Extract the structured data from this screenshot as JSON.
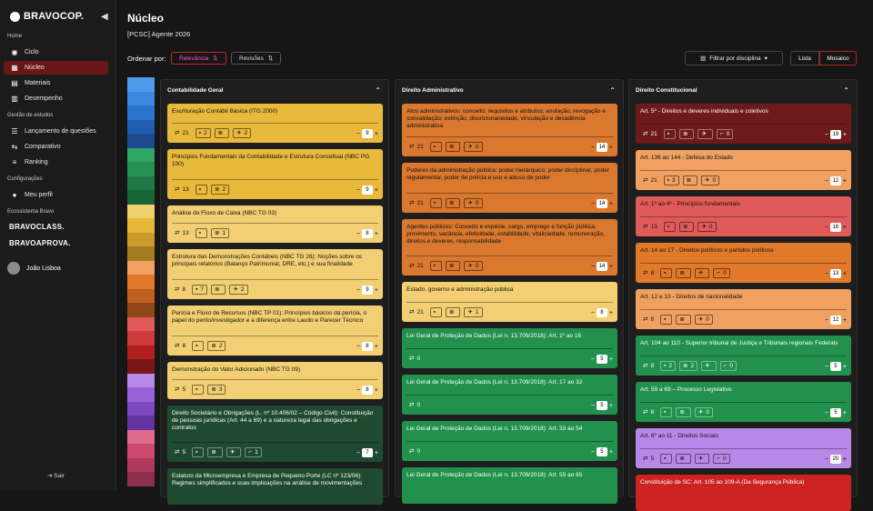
{
  "app": {
    "brand": "BRAVOCOP.",
    "page_title": "Núcleo",
    "subtitle": "[PCSC] Agente 2026"
  },
  "sidebar": {
    "sections": [
      "Home",
      "Gestão de estudos",
      "Configurações",
      "Ecossistema Bravo"
    ],
    "items": [
      {
        "label": "Ciclo",
        "icon": "cycle-icon"
      },
      {
        "label": "Núcleo",
        "icon": "grid-icon"
      },
      {
        "label": "Materiais",
        "icon": "book-icon"
      },
      {
        "label": "Desempenho",
        "icon": "chart-icon"
      },
      {
        "label": "Lançamento de questões",
        "icon": "list-icon"
      },
      {
        "label": "Comparativo",
        "icon": "compare-icon"
      },
      {
        "label": "Ranking",
        "icon": "ranking-icon"
      },
      {
        "label": "Meu perfil",
        "icon": "user-icon"
      }
    ],
    "ecosystem": [
      "BRAVOCLASS.",
      "BRAVOAPROVA."
    ],
    "user": "João Lisboa",
    "logout": "Sair"
  },
  "sort": {
    "label": "Ordenar por:",
    "options": [
      "Relevância",
      "Revisões"
    ]
  },
  "filter": {
    "label": "Filtrar por disciplina"
  },
  "view": {
    "list": "Lista",
    "mosaic": "Mosaico"
  },
  "strip_colors": [
    "#4f9ae8",
    "#3a88e0",
    "#2b74cc",
    "#1f5eb0",
    "#1c4a8f",
    "#2fa765",
    "#249052",
    "#1e7a44",
    "#186436",
    "#f0cf6e",
    "#e7b93a",
    "#cc9a2a",
    "#a37c22",
    "#f0a060",
    "#e07a2a",
    "#c0601e",
    "#8f4716",
    "#e05a5a",
    "#cc3a3a",
    "#b01e1e",
    "#7a1616",
    "#b888e8",
    "#9a62d8",
    "#7e48c0",
    "#6234a0",
    "#e06a8a",
    "#cc4a70",
    "#b03a5e",
    "#8f2e4c"
  ],
  "columns": [
    {
      "title": "Contabilidade Geral",
      "cards": [
        {
          "title": "Escrituração Contábil Básica (ITG 2000)",
          "color": "#e9b93c",
          "tags": [
            "21",
            "2",
            "",
            "2"
          ],
          "count": "9"
        },
        {
          "title": "Princípios Fundamentais da Contabilidade e Estrutura Conceitual (NBC PG 100)",
          "color": "#e9b93c",
          "tags": [
            "13",
            "",
            "2"
          ],
          "count": "9"
        },
        {
          "title": "Análise do Fluxo de Caixa (NBC TG 03)",
          "color": "#f2cf72",
          "tags": [
            "13",
            "",
            "1"
          ],
          "count": "8"
        },
        {
          "title": "Estrutura das Demonstrações Contábeis (NBC TG 26): Noções sobre os principais relatórios (Balanço Patrimonial, DRE, etc.) e sua finalidade",
          "color": "#f2cf72",
          "tags": [
            "8",
            "7",
            "",
            "2"
          ],
          "count": "9"
        },
        {
          "title": "Perícia e Fluxo de Recursos (NBC TP 01): Princípios básicos da perícia, o papel do perito/investigador e a diferença entre Laudo e Parecer Técnico",
          "color": "#f2cf72",
          "tags": [
            "8",
            "",
            "2"
          ],
          "count": "8"
        },
        {
          "title": "Demonstração do Valor Adicionado (NBC TG 09)",
          "color": "#f2cf72",
          "tags": [
            "5",
            "",
            "3"
          ],
          "count": "8"
        },
        {
          "title": "Direito Societário e Obrigações (L. nº 10.406/02 – Código Civil): Constituição de pessoas jurídicas (Art. 44 a 69) e a natureza legal das obrigações e contratos",
          "color": "#1e4a30",
          "tags": [
            "5",
            "",
            "",
            "",
            "1"
          ],
          "count": "7"
        },
        {
          "title": "Estatuto da Microempresa e Empresa de Pequeno Porte (LC nº 123/06): Regimes simplificados e suas implicações na análise de movimentações",
          "color": "#1e4a30",
          "tags": [],
          "count": ""
        }
      ]
    },
    {
      "title": "Direito Administrativo",
      "cards": [
        {
          "title": "Atos administrativos: conceito; requisitos e atributos; anulação, revogação e convalidação; extinção, discricionariedade, vinculação e decadência administrativa",
          "color": "#d9782e",
          "tags": [
            "21",
            "",
            "",
            "0"
          ],
          "count": "14"
        },
        {
          "title": "Poderes da administração pública: poder hierárquico; poder disciplinar, poder regulamentar, poder de polícia e uso e abuso de poder",
          "color": "#d9782e",
          "tags": [
            "21",
            "",
            "",
            "0"
          ],
          "count": "14"
        },
        {
          "title": "Agentes públicos: Conceito e espécie, cargo, emprego e função pública, provimento, vacância, efetividade, estabilidade, vitaliciedade, remuneração, direitos e deveres, responsabilidade",
          "color": "#d9782e",
          "tags": [
            "21",
            "",
            "",
            "0"
          ],
          "count": "14"
        },
        {
          "title": "Estado, governo e administração pública",
          "color": "#f2cf72",
          "tags": [
            "21",
            "",
            "",
            "1"
          ],
          "count": "8"
        },
        {
          "title": "Lei Geral de Proteção de Dados (Lei n. 13.709/2018): Art. 1º ao 16",
          "color": "#22914e",
          "tags": [
            "0"
          ],
          "count": "5"
        },
        {
          "title": "Lei Geral de Proteção de Dados (Lei n. 13.709/2018): Art. 17 ao 32",
          "color": "#22914e",
          "tags": [
            "0"
          ],
          "count": "5"
        },
        {
          "title": "Lei Geral de Proteção de Dados (Lei n. 13.709/2018): Art. 33 ao 54",
          "color": "#22914e",
          "tags": [
            "0"
          ],
          "count": "5"
        },
        {
          "title": "Lei Geral de Proteção de Dados (Lei n. 13.709/2018): Art. 55 ao 65",
          "color": "#22914e",
          "tags": [],
          "count": ""
        }
      ]
    },
    {
      "title": "Direito Constitucional",
      "cards": [
        {
          "title": "Art. 5º - Direitos e deveres individuais e coletivos",
          "color": "#6e1a1a",
          "tags": [
            "21",
            "",
            "",
            "",
            "0"
          ],
          "count": "19"
        },
        {
          "title": "Art. 136 ao 144 - Defesa do Estado",
          "color": "#f0a060",
          "tags": [
            "21",
            "3",
            "",
            "0"
          ],
          "count": "12"
        },
        {
          "title": "Art. 1º ao 4º - Princípios fundamentais",
          "color": "#e05a5a",
          "tags": [
            "13",
            "",
            "",
            "0"
          ],
          "count": "16"
        },
        {
          "title": "Art. 14 ao 17 - Direitos políticos e partidos políticos",
          "color": "#e07a2a",
          "tags": [
            "8",
            "",
            "",
            "",
            "0"
          ],
          "count": "13"
        },
        {
          "title": "Art. 12 e 13 - Direitos de nacionalidade",
          "color": "#f0a060",
          "tags": [
            "8",
            "",
            "",
            "0"
          ],
          "count": "12"
        },
        {
          "title": "Art. 104 ao 110 - Superior tribunal de Justiça e Tribunais regionais Federais",
          "color": "#22914e",
          "tags": [
            "8",
            "2",
            "2",
            "",
            "0"
          ],
          "count": "5"
        },
        {
          "title": "Art. 59 a 69 – Processo Legislativo",
          "color": "#22914e",
          "tags": [
            "8",
            "",
            "",
            "0"
          ],
          "count": "5"
        },
        {
          "title": "Art. 6º ao 11 - Direitos Sociais",
          "color": "#b888e8",
          "tags": [
            "5",
            "",
            "",
            "",
            "0"
          ],
          "count": "20"
        },
        {
          "title": "Constituição de SC: Art. 105 ao 109-A (Da Segurança Pública)",
          "color": "#cc2222",
          "tags": [],
          "count": ""
        }
      ]
    }
  ]
}
